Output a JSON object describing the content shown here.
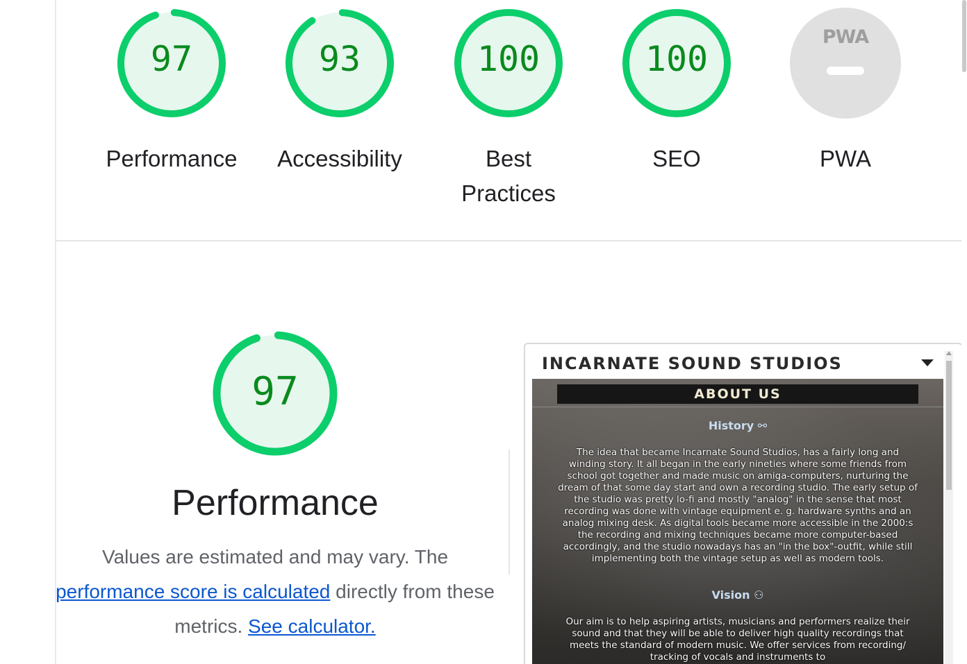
{
  "colors": {
    "pass": "#0cce6b",
    "pass_fill": "#e6f7ee",
    "pass_text": "#0a8a1d",
    "na": "#e0e0e0",
    "link": "#0b57d0"
  },
  "gauges": [
    {
      "label": "Performance",
      "score": "97",
      "value": 0.97
    },
    {
      "label": "Accessibility",
      "score": "93",
      "value": 0.93
    },
    {
      "label": "Best Practices",
      "label_line1": "Best",
      "label_line2": "Practices",
      "score": "100",
      "value": 1.0
    },
    {
      "label": "SEO",
      "score": "100",
      "value": 1.0
    },
    {
      "label": "PWA",
      "badge": "PWA",
      "score": "",
      "value": null
    }
  ],
  "performance": {
    "score": "97",
    "value": 0.97,
    "title": "Performance",
    "desc_line1": "Values are estimated and may vary. The",
    "desc_link1": "performance score is calculated",
    "desc_line2_tail": " directly from these",
    "desc_line3_head": "metrics. ",
    "desc_link2": "See calculator."
  },
  "screenshot": {
    "brand": "INCARNATE SOUND STUDIOS",
    "about": "ABOUT US",
    "history_heading": "History ⚯",
    "history_text": "The idea that became Incarnate Sound Studios, has a fairly long and winding story. It all began in the early nineties where some friends from school got together and made music on amiga-computers, nurturing the dream of that some day start and own a recording studio. The early setup of the studio was pretty lo-fi and mostly \"analog\" in the sense that most recording was done with vintage equipment e. g. hardware synths and an analog mixing desk. As digital tools became more accessible in the 2000:s the recording and mixing techniques became more computer-based accordingly, and the studio nowadays has an \"in the box\"-outfit, while still implementing both the vintage setup as well as modern tools.",
    "vision_heading": "Vision ⚇",
    "vision_text": "Our aim is to help aspiring artists, musicians and performers realize their sound and that they will be able to deliver high quality recordings that meets the standard of modern music. We offer services from recording/ tracking of vocals and instruments to"
  }
}
